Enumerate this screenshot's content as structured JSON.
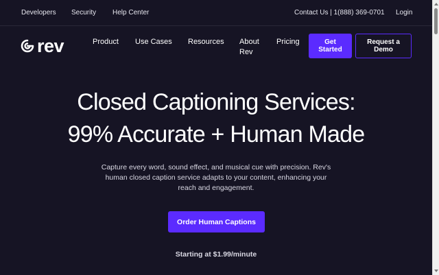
{
  "topbar": {
    "developers": "Developers",
    "security": "Security",
    "help_center": "Help Center",
    "contact": "Contact Us | 1(888) 369-0701",
    "login": "Login"
  },
  "logo": {
    "text": "rev",
    "icon": "rev-logo-icon"
  },
  "nav": {
    "product": "Product",
    "use_cases": "Use Cases",
    "resources": "Resources",
    "about_line1": "About",
    "about_line2": "Rev",
    "pricing": "Pricing",
    "get_started_line1": "Get",
    "get_started_line2": "Started",
    "request_demo_line1": "Request a",
    "request_demo_line2": "Demo"
  },
  "hero": {
    "title_line1": "Closed Captioning Services:",
    "title_line2": "99% Accurate + Human Made",
    "subtitle": "Capture every word, sound effect, and musical cue with precision. Rev's human closed caption service adapts to your content, enhancing your reach and engagement.",
    "cta": "Order Human Captions",
    "price_note": "Starting at $1.99/minute"
  },
  "colors": {
    "background": "#161424",
    "accent": "#5b2bff",
    "text": "#ffffff",
    "muted_text": "#d9d8e3"
  }
}
